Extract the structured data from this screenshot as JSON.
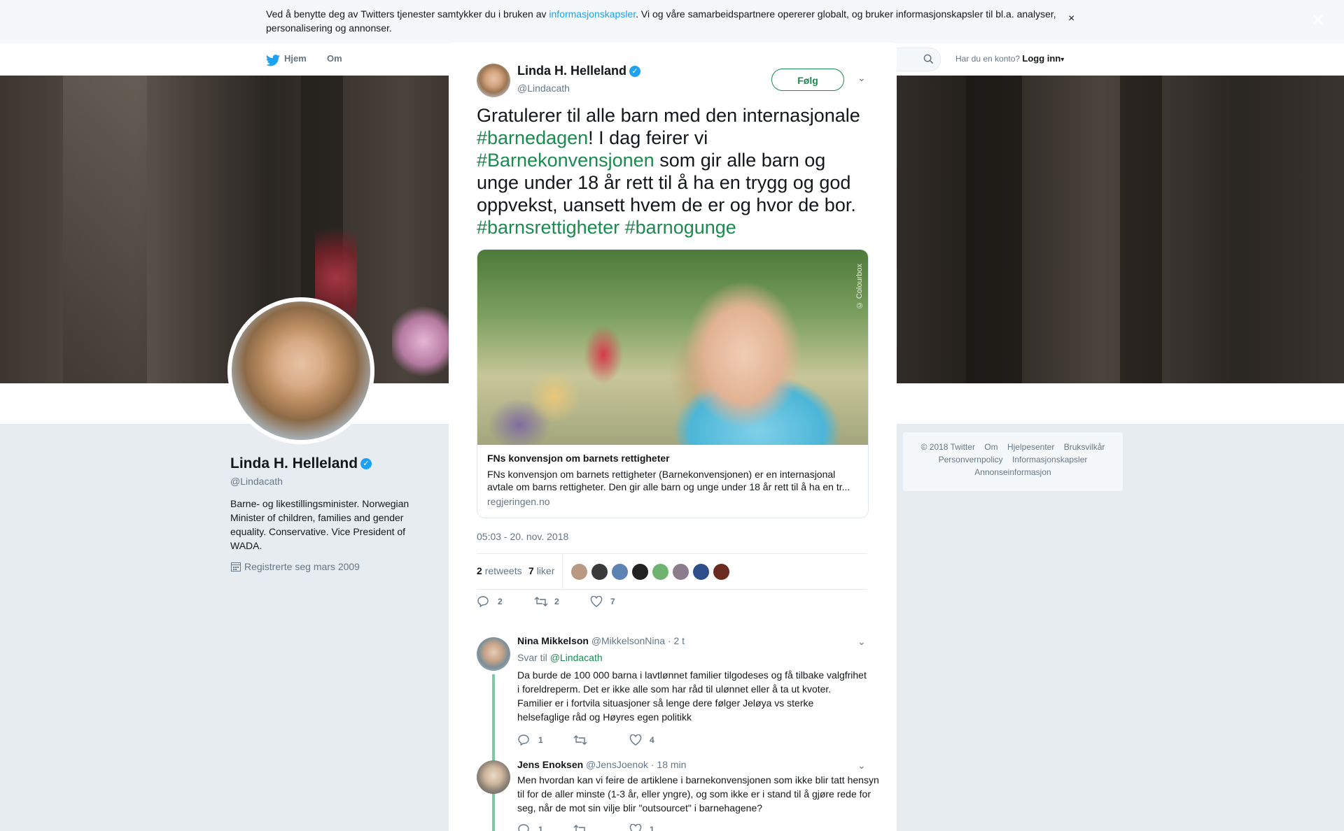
{
  "cookie_bar": {
    "text_before": "Ved å benytte deg av Twitters tjenester samtykker du i bruken av ",
    "link": "informasjonskapsler",
    "text_after": ". Vi og våre samarbeidspartnere opererer globalt, og bruker informasjonskapsler til bl.a. analyser, personalisering og annonser.",
    "close": "×"
  },
  "nav": {
    "home": "Hjem",
    "about": "Om",
    "account_prompt": "Har du en konto?",
    "login": "Logg inn",
    "login_caret": "▾"
  },
  "profile": {
    "name": "Linda H. Helleland",
    "handle": "@Lindacath",
    "bio": "Barne- og likestillingsminister. Norwegian Minister of children, families and gender equality. Conservative. Vice President of WADA.",
    "joined": "Registrerte seg mars 2009"
  },
  "footer": {
    "row1": [
      "© 2018 Twitter",
      "Om",
      "Hjelpesenter",
      "Bruksvilkår"
    ],
    "row2": [
      "Personvernpolicy",
      "Informasjonskapsler"
    ],
    "row3": [
      "Annonseinformasjon"
    ]
  },
  "modal": {
    "close": "×",
    "author_name": "Linda H. Helleland",
    "author_handle": "@Lindacath",
    "verified": "✓",
    "follow_label": "Følg",
    "tweet": {
      "t1": "Gratulerer til alle barn med den internasjonale ",
      "h1": "#barnedagen",
      "t2": "! I dag feirer vi ",
      "h2": "#Barnekonvensjonen",
      "t3": " som gir alle barn og unge under 18 år rett til å ha en trygg og god oppvekst, uansett hvem de er og hvor de bor. ",
      "h3": "#barnsrettigheter",
      "t4": " ",
      "h4": "#barnogunge"
    },
    "card": {
      "credit": "© Colourbox",
      "title": "FNs konvensjon om barnets rettigheter",
      "description": "FNs konvensjon om barnets rettigheter (Barnekonvensjonen) er en internasjonal avtale om barns rettigheter. Den gir alle barn og unge under 18 år rett til å ha en tr...",
      "domain": "regjeringen.no"
    },
    "timestamp": "05:03 - 20. nov. 2018",
    "stats": {
      "retweets_count": "2",
      "retweets_label": "retweets",
      "likes_count": "7",
      "likes_label": "liker"
    },
    "actions": {
      "replies": "2",
      "retweets": "2",
      "likes": "7"
    }
  },
  "replies": [
    {
      "name": "Nina Mikkelson",
      "handle": "@MikkelsonNina",
      "time": "· 2 t",
      "reply_to_label": "Svar til ",
      "reply_to_handle": "@Lindacath",
      "text": "Da burde de 100 000 barna  i lavtlønnet familier tilgodeses og få tilbake valgfrihet i foreldreperm. Det er ikke alle som har råd til ulønnet eller å ta ut kvoter. Familier er i fortvila situasjoner så lenge dere følger Jeløya vs sterke helsefaglige råd og Høyres egen politikk",
      "replies": "1",
      "retweets": "",
      "likes": "4"
    },
    {
      "name": "Jens Enoksen",
      "handle": "@JensJoenok",
      "time": "· 18 min",
      "text": "Men hvordan kan vi feire de artiklene i barnekonvensjonen som ikke blir tatt hensyn til for de aller minste (1-3 år, eller yngre), og som ikke er i stand til å gjøre rede for seg, når de mot sin vilje blir \"outsourcet\" i barnehagene?",
      "replies": "1",
      "retweets": "",
      "likes": "1"
    }
  ],
  "colors": {
    "accent_green": "#1b8a4f",
    "twitter_blue": "#1da1f2",
    "muted": "#657786",
    "thread_line": "#82c7a5"
  },
  "icons": [
    "twitter-bird-icon",
    "search-icon",
    "close-icon",
    "verified-icon",
    "chevron-down-icon",
    "calendar-icon",
    "reply-icon",
    "retweet-icon",
    "like-icon"
  ]
}
